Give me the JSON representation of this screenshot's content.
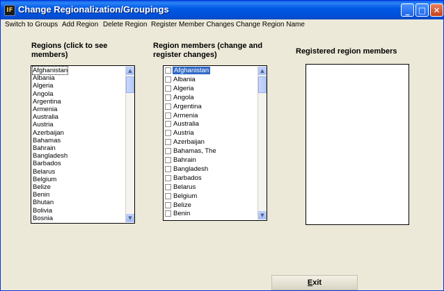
{
  "window": {
    "title": "Change Regionalization/Groupings",
    "app_icon_glyph": "IF",
    "minimize_glyph": "_",
    "maximize_glyph": "□",
    "close_glyph": "✕"
  },
  "menu": [
    "Switch to Groups",
    "Add Region",
    "Delete Region",
    "Register Member Changes",
    "Change Region Name"
  ],
  "regions": {
    "heading_line1": "Regions (click to see",
    "heading_line2": "members)",
    "items": [
      "Afghanistan",
      "Albania",
      "Algeria",
      "Angola",
      "Argentina",
      "Armenia",
      "Australia",
      "Austria",
      "Azerbaijan",
      "Bahamas",
      "Bahrain",
      "Bangladesh",
      "Barbados",
      "Belarus",
      "Belgium",
      "Belize",
      "Benin",
      "Bhutan",
      "Bolivia",
      "Bosnia"
    ]
  },
  "members": {
    "heading_line1": "Region members (change and",
    "heading_line2": "register changes)",
    "items": [
      "Afghanistan",
      "Albania",
      "Algeria",
      "Angola",
      "Argentina",
      "Armenia",
      "Australia",
      "Austria",
      "Azerbaijan",
      "Bahamas, The",
      "Bahrain",
      "Bangladesh",
      "Barbados",
      "Belarus",
      "Belgium",
      "Belize",
      "Benin"
    ]
  },
  "registered": {
    "heading": "Registered region members"
  },
  "scroll_arrows": {
    "up": "▲",
    "down": "▼"
  },
  "exit_button": {
    "label_first": "E",
    "label_rest": "xit"
  },
  "colors": {
    "title_bar": "#0058e6",
    "selection": "#316ac5",
    "window_bg": "#ece9d8"
  }
}
